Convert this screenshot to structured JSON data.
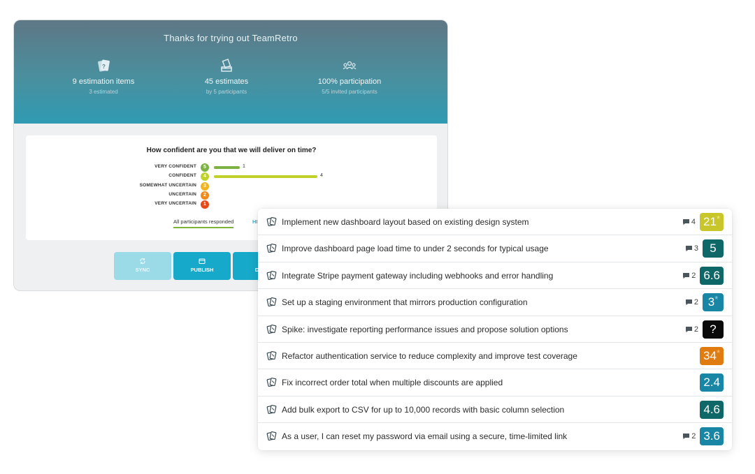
{
  "summary": {
    "title": "Thanks for trying out TeamRetro",
    "stats": [
      {
        "icon": "cards-icon",
        "main": "9 estimation items",
        "sub": "3 estimated"
      },
      {
        "icon": "ballot-box-icon",
        "main": "45 estimates",
        "sub": "by 5 participants"
      },
      {
        "icon": "participants-icon",
        "main": "100% participation",
        "sub": "5/5 invited participants"
      }
    ]
  },
  "question": {
    "title": "How confident are you that we will deliver on time?",
    "options": [
      {
        "label": "VERY CONFIDENT",
        "value": "5",
        "count": 1,
        "color": "#7cb342"
      },
      {
        "label": "CONFIDENT",
        "value": "4",
        "count": 4,
        "color": "#c0d12a"
      },
      {
        "label": "SOMEWHAT UNCERTAIN",
        "value": "3",
        "count": 0,
        "color": "#f4b320"
      },
      {
        "label": "UNCERTAIN",
        "value": "2",
        "count": 0,
        "color": "#ef8a1b"
      },
      {
        "label": "VERY UNCERTAIN",
        "value": "1",
        "count": 0,
        "color": "#e64a19"
      }
    ],
    "count_labels": [
      "1",
      "4"
    ],
    "tabs": {
      "active": "All participants responded",
      "other": "HI"
    }
  },
  "actions": {
    "sync": "SYNC",
    "publish": "PUBLISH",
    "download": "DOW"
  },
  "items": [
    {
      "text": "Implement new dashboard layout based on existing design system",
      "comments": "4",
      "score": "21",
      "star": true,
      "color": "#c9c62c"
    },
    {
      "text": "Improve dashboard page load time to under 2 seconds for typical usage",
      "comments": "3",
      "score": "5",
      "star": false,
      "color": "#0f6868"
    },
    {
      "text": "Integrate Stripe payment gateway including webhooks and error handling",
      "comments": "2",
      "score": "6.6",
      "star": false,
      "color": "#0f6868"
    },
    {
      "text": "Set up a staging environment that mirrors production configuration",
      "comments": "2",
      "score": "3",
      "star": true,
      "color": "#1986a5"
    },
    {
      "text": "Spike: investigate reporting performance issues and propose solution options",
      "comments": "2",
      "score": "?",
      "star": false,
      "color": "#0a0a0a"
    },
    {
      "text": "Refactor authentication service to reduce complexity and improve test coverage",
      "comments": "",
      "score": "34",
      "star": true,
      "color": "#e07b10"
    },
    {
      "text": "Fix incorrect order total when multiple discounts are applied",
      "comments": "",
      "score": "2.4",
      "star": false,
      "color": "#1986a5"
    },
    {
      "text": "Add bulk export to CSV for up to 10,000 records with basic column selection",
      "comments": "",
      "score": "4.6",
      "star": false,
      "color": "#0f6868"
    },
    {
      "text": "As a user, I can reset my password via email using a secure, time-limited link",
      "comments": "2",
      "score": "3.6",
      "star": false,
      "color": "#1986a5"
    }
  ]
}
